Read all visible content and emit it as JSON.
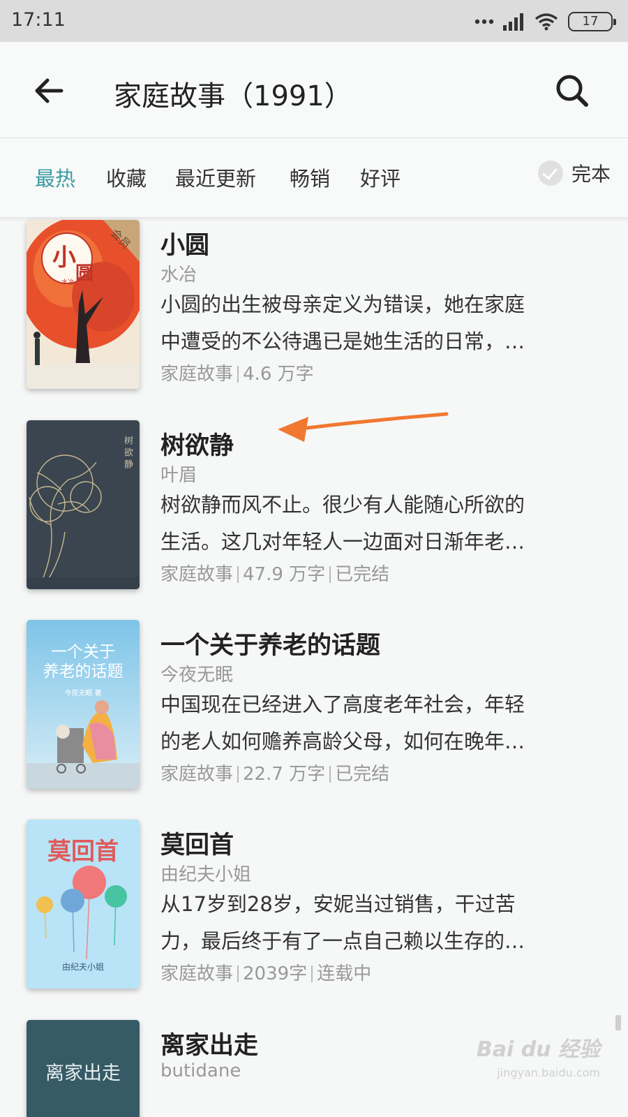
{
  "status_bar": {
    "time": "17:11",
    "battery": "17"
  },
  "header": {
    "title": "家庭故事（1991）",
    "back_icon": "arrow-left-icon",
    "search_icon": "search-icon"
  },
  "filters": {
    "tabs": [
      {
        "label": "最热",
        "active": true
      },
      {
        "label": "收藏",
        "active": false
      },
      {
        "label": "最近更新",
        "active": false
      },
      {
        "label": "畅销",
        "active": false
      },
      {
        "label": "好评",
        "active": false
      }
    ],
    "complete_label": "完本"
  },
  "books": [
    {
      "title": "小圆",
      "author": "水冶",
      "desc_line1": "小圆的出生被母亲定义为错误，她在家庭",
      "desc_line2": "中遭受的不公待遇已是她生活的日常，…",
      "category": "家庭故事",
      "words": "4.6 万字",
      "status": "",
      "cover": {
        "title_char1": "小",
        "title_char2": "圆",
        "badge": "会员",
        "author_mark": "水冶"
      }
    },
    {
      "title": "树欲静",
      "author": "叶眉",
      "desc_line1": "树欲静而风不止。很少有人能随心所欲的",
      "desc_line2": "生活。这几对年轻人一边面对日渐年老…",
      "category": "家庭故事",
      "words": "47.9 万字",
      "status": "已完结",
      "cover": {
        "title": "树欲静"
      }
    },
    {
      "title": "一个关于养老的话题",
      "author": "今夜无眠",
      "desc_line1": "中国现在已经进入了高度老年社会，年轻",
      "desc_line2": "的老人如何赡养高龄父母，如何在晚年…",
      "category": "家庭故事",
      "words": "22.7 万字",
      "status": "已完结",
      "cover": {
        "line1": "一个关于",
        "line2": "养老的话题",
        "author": "今夜无眠 著"
      }
    },
    {
      "title": "莫回首",
      "author": "由纪夫小姐",
      "desc_line1": "从17岁到28岁，安妮当过销售，干过苦",
      "desc_line2": "力，最后终于有了一点自己赖以生存的…",
      "category": "家庭故事",
      "words": "2039字",
      "status": "连载中",
      "cover": {
        "title": "莫回首",
        "author": "由纪夫小姐"
      }
    },
    {
      "title": "离家出走",
      "author": "butidane",
      "cover": {
        "title": "离家出走"
      }
    }
  ],
  "watermark": {
    "main": "Bai du 经验",
    "sub": "jingyan.baidu.com"
  },
  "colors": {
    "accent": "#3a9aa0",
    "annotation_arrow": "#f07830"
  }
}
